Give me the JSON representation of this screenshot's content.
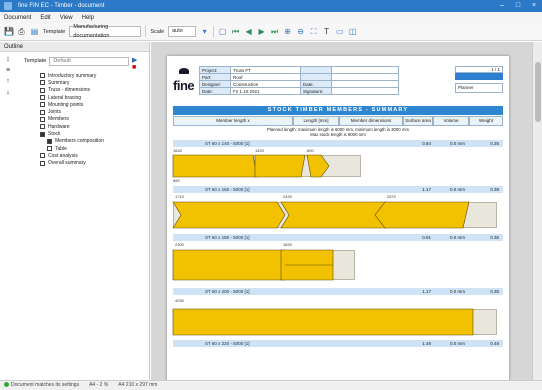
{
  "window": {
    "title": "fine FIN EC - Timber - document"
  },
  "menu": {
    "items": [
      "Document",
      "Edit",
      "View",
      "Help"
    ]
  },
  "toolbar": {
    "template_label": "Template",
    "template_value": "Manufacturing documentation",
    "scale_label": "Scale",
    "scale_value": "auto"
  },
  "sidebar": {
    "title": "Outline",
    "filter_label": "Template",
    "filter_placeholder": "Default",
    "items": [
      {
        "label": "Introductory summary",
        "checked": false,
        "sub": false
      },
      {
        "label": "Summary",
        "checked": false,
        "sub": false
      },
      {
        "label": "Truss - dimensions",
        "checked": false,
        "sub": false
      },
      {
        "label": "Lateral bracing",
        "checked": false,
        "sub": false
      },
      {
        "label": "Mounting points",
        "checked": false,
        "sub": false
      },
      {
        "label": "Joints",
        "checked": false,
        "sub": false
      },
      {
        "label": "Members",
        "checked": false,
        "sub": false
      },
      {
        "label": "Hardware",
        "checked": false,
        "sub": false
      },
      {
        "label": "Stock",
        "checked": true,
        "sub": false
      },
      {
        "label": "Members composition",
        "checked": true,
        "sub": true
      },
      {
        "label": "Table",
        "checked": false,
        "sub": true
      },
      {
        "label": "Cost analysis",
        "checked": false,
        "sub": false
      },
      {
        "label": "Overall summary",
        "checked": false,
        "sub": false
      }
    ]
  },
  "report": {
    "logo_text": "fine",
    "info_rows": [
      {
        "l1": "Project:",
        "v1": "Truss FT",
        "l2": "",
        "v2": ""
      },
      {
        "l1": "Part:",
        "v1": "Roof",
        "l2": "",
        "v2": ""
      },
      {
        "l1": "Designer:",
        "v1": "Construction",
        "l2": "Date:",
        "v2": ""
      },
      {
        "l1": "Date:",
        "v1": "Fri 1.10.2021",
        "l2": "Signature:",
        "v2": ""
      }
    ],
    "page_label": "1 / 1",
    "page_badge": "",
    "right_box": "Planner",
    "section_title": "STOCK TIMBER MEMBERS - SUMMARY",
    "columns": [
      "Member length x",
      "Length [mm]",
      "Member dimensions",
      "Surface area",
      "Volume",
      "Weight"
    ],
    "notes": [
      "Planned length: maximum length is 6000 mm, minimum length is 3000 mm",
      "Max stock length is 6000 mm"
    ]
  },
  "groups": [
    {
      "header": "ST 60 x 140 - 5000 [1]",
      "values": [
        "0.84",
        "0.0 mm",
        "0.35"
      ],
      "labels": [
        "1640",
        "1420",
        "600",
        "560"
      ]
    },
    {
      "header": "ST 60 x 160 - 5000 [1]",
      "values": [
        "1.17",
        "0.0 mm",
        "0.38"
      ],
      "labels": [
        "1710",
        "2420",
        "2570"
      ]
    },
    {
      "header": "ST 60 x 180 - 5000 [1]",
      "values": [
        "0.91",
        "0.0 mm",
        "0.35"
      ],
      "labels": [
        "2300",
        "1820"
      ]
    },
    {
      "header": "ST 60 x 200 - 5000 [1]",
      "values": [
        "1.17",
        "0.0 mm",
        "0.35"
      ],
      "labels": [
        "4250"
      ]
    },
    {
      "header": "ST 60 x 220 - 5000 [1]",
      "values": [
        "1.48",
        "0.0 mm",
        "0.48"
      ],
      "labels": []
    }
  ],
  "colors": {
    "accent": "#2e86d0",
    "piece_fill": "#f2c200",
    "piece_stroke": "#5a4a00",
    "stock_fill": "#e9e6dc"
  },
  "statusbar": {
    "left": "Document matches its settings",
    "mid": "A4 - 2 %",
    "right": "A4 210 x 297 mm"
  }
}
